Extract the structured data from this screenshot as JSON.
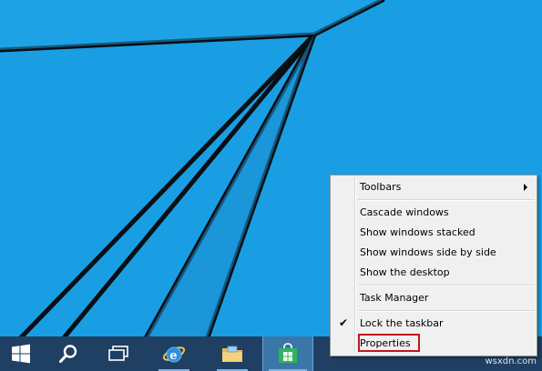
{
  "menu": {
    "items": [
      {
        "label": "Toolbars",
        "submenu": true
      },
      {
        "label": "Cascade windows"
      },
      {
        "label": "Show windows stacked"
      },
      {
        "label": "Show windows side by side"
      },
      {
        "label": "Show the desktop"
      },
      {
        "label": "Task Manager"
      },
      {
        "label": "Lock the taskbar",
        "checked": true
      },
      {
        "label": "Properties",
        "highlighted": true
      }
    ]
  },
  "taskbar": {
    "buttons": [
      {
        "icon": "windows-start-icon"
      },
      {
        "icon": "search-icon"
      },
      {
        "icon": "task-view-icon"
      },
      {
        "icon": "internet-explorer-icon"
      },
      {
        "icon": "file-explorer-icon"
      },
      {
        "icon": "store-icon",
        "active": true
      }
    ]
  },
  "colors": {
    "desktop": "#1a9ee3",
    "taskbar": "#1f3f63",
    "highlight_border": "#c0161c"
  },
  "watermark": "wsxdn.com"
}
